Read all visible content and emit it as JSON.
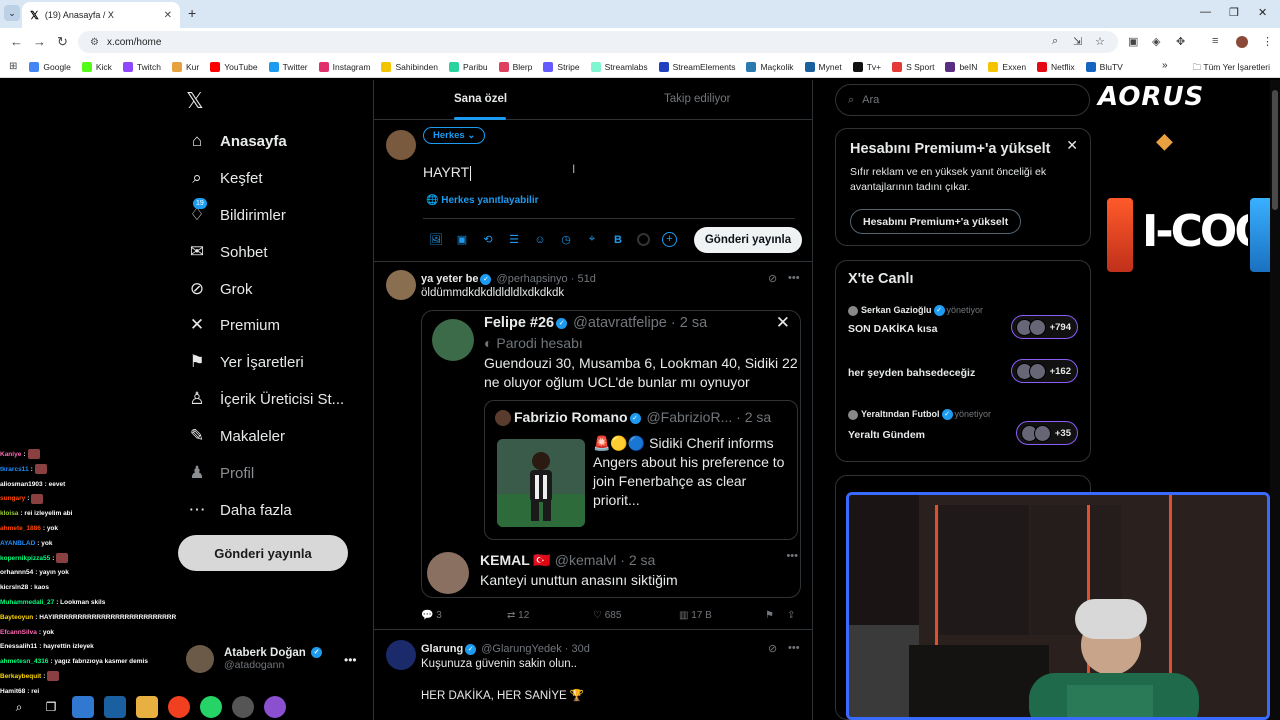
{
  "browser": {
    "tab_title": "(19) Anasayfa / X",
    "address": "x.com/home",
    "bookmarks": [
      "Google",
      "Kick",
      "Twitch",
      "Kur",
      "YouTube",
      "Twitter",
      "Instagram",
      "Sahibinden",
      "Paribu",
      "Blerp",
      "Stripe",
      "Streamlabs",
      "StreamElements",
      "Maçkolik",
      "Mynet",
      "Tv+",
      "S Sport",
      "beIN",
      "Exxen",
      "Netflix",
      "BluTV"
    ],
    "bookmark_colors": [
      "#4285f4",
      "#53fc18",
      "#9146ff",
      "#e6a23c",
      "#ff0000",
      "#1d9bf0",
      "#e1306c",
      "#f4c400",
      "#2ad4a0",
      "#e04060",
      "#635bff",
      "#80f5d2",
      "#2040c0",
      "#2a7ab0",
      "#1a5f9e",
      "#111111",
      "#e53935",
      "#5a2d82",
      "#f5c400",
      "#e50914",
      "#1565c0"
    ],
    "all_bookmarks": "Tüm Yer İşaretleri"
  },
  "nav": {
    "items": [
      {
        "label": "Anasayfa",
        "icon": "home-icon",
        "glyph": "⌂"
      },
      {
        "label": "Keşfet",
        "icon": "search-icon",
        "glyph": "⌕"
      },
      {
        "label": "Bildirimler",
        "icon": "bell-icon",
        "glyph": "♢"
      },
      {
        "label": "Sohbet",
        "icon": "mail-icon",
        "glyph": "✉"
      },
      {
        "label": "Grok",
        "icon": "grok-icon",
        "glyph": "⊘"
      },
      {
        "label": "Premium",
        "icon": "x-icon",
        "glyph": "✕"
      },
      {
        "label": "Yer İşaretleri",
        "icon": "bookmark-icon",
        "glyph": "⚑"
      },
      {
        "label": "İçerik Üreticisi St...",
        "icon": "creator-icon",
        "glyph": "♙"
      },
      {
        "label": "Makaleler",
        "icon": "article-icon",
        "glyph": "✎"
      },
      {
        "label": "Profil",
        "icon": "profile-icon",
        "glyph": "♟"
      },
      {
        "label": "Daha fazla",
        "icon": "more-icon",
        "glyph": "⋯"
      }
    ],
    "notif_count": "19",
    "post_button": "Gönderi yayınla",
    "account_name": "Ataberk Doğan",
    "account_handle": "@atadogann"
  },
  "chat": [
    {
      "user": "Kaniye",
      "color": "#ff69b4",
      "msg": ":"
    },
    {
      "user": "tkrarcs11",
      "color": "#1e90ff",
      "msg": ":"
    },
    {
      "user": "aliosman1903",
      "color": "#fff",
      "msg": ": eevet"
    },
    {
      "user": "sungary",
      "color": "#ff4500",
      "msg": ":"
    },
    {
      "user": "kloisa",
      "color": "#9acd32",
      "msg": ": rei izleyelim abi"
    },
    {
      "user": "ahmete_1886",
      "color": "#ff4500",
      "msg": ": yok"
    },
    {
      "user": "AYANBLAD",
      "color": "#1e90ff",
      "msg": ": yok"
    },
    {
      "user": "kopernikpizza55",
      "color": "#00ff7f",
      "msg": ":"
    },
    {
      "user": "orhannn54",
      "color": "#fff",
      "msg": ": yayın yok"
    },
    {
      "user": "kicrsln28",
      "color": "#fff",
      "msg": ": kaos"
    },
    {
      "user": "Muhammedali_27",
      "color": "#00ff7f",
      "msg": ": Lookman skils"
    },
    {
      "user": "Bayteoyun",
      "color": "#ffd700",
      "msg": ": HAYIRRRRRRRRRRRRRRRRRRRRRRRRRRRRRRRRRRRR"
    },
    {
      "user": "EfcannSilva",
      "color": "#ff69b4",
      "msg": ": yok"
    },
    {
      "user": "Enessalih11",
      "color": "#fff",
      "msg": ": hayrettin izleyek"
    },
    {
      "user": "ahmetesn_4316",
      "color": "#00ff7f",
      "msg": ": yagız fabrızıoya kasmer demis"
    },
    {
      "user": "Berkaybequit",
      "color": "#ffd700",
      "msg": ":"
    },
    {
      "user": "Hamit68",
      "color": "#fff",
      "msg": ": rei"
    }
  ],
  "timeline": {
    "tab_foryou": "Sana özel",
    "tab_following": "Takip ediliyor",
    "audience": "Herkes",
    "draft": "HAYRT",
    "reply_setting": "Herkes yanıtlayabilir",
    "post_button": "Gönderi yayınla",
    "tools": [
      "🖼",
      "▣",
      "⟲",
      "☰",
      "☺",
      "◷",
      "⌖",
      "B"
    ]
  },
  "tweet1": {
    "name": "ya yeter be",
    "handle": "@perhapsinyo",
    "time": "51d",
    "text": "öldümmdkdkdldldldlxdkdkdk",
    "quote": {
      "name": "Felipe #26",
      "handle": "@atavratfelipe",
      "time": "2 sa",
      "sub": "Parodi hesabı",
      "text": "Guendouzi 30, Musamba 6, Lookman 40, Sidiki 22 ne oluyor oğlum UCL'de bunlar mı oynuyor",
      "inner": {
        "name": "Fabrizio Romano",
        "handle": "@FabrizioR...",
        "time": "2 sa",
        "text": "🚨🟡🔵 Sidiki Cherif informs Angers about his preference to join Fenerbahçe as clear priorit..."
      },
      "reply": {
        "name": "KEMAL 🇹🇷",
        "handle": "@kemalvl",
        "time": "2 sa",
        "text": "Kanteyi unuttun anasını siktiğim"
      }
    },
    "replies": "3",
    "retweets": "12",
    "likes": "685",
    "views": "17 B"
  },
  "tweet2": {
    "name": "Glarung",
    "handle": "@GlarungYedek",
    "time": "30d",
    "text": "Kuşunuza güvenin sakin olun..",
    "text2": "HER DAKİKA, HER SANİYE 🏆"
  },
  "sidebar": {
    "search_placeholder": "Ara",
    "premium_title": "Hesabını Premium+'a yükselt",
    "premium_desc": "Sıfır reklam ve en yüksek yanıt önceliği ek avantajlarının tadını çıkar.",
    "premium_button": "Hesabını Premium+'a yükselt",
    "live_title": "X'te Canlı",
    "spaces": [
      {
        "host": "Serkan Gazioğlu",
        "role": "yönetiyor",
        "name": "SON DAKİKA kısa",
        "count": "+794"
      },
      {
        "host": "",
        "role": "",
        "name": "her şeyden bahsedeceğiz",
        "count": "+162"
      },
      {
        "host": "Yeraltından Futbol",
        "role": "yönetiyor",
        "name": "Yeraltı Gündem",
        "count": "+35"
      }
    ]
  },
  "overlay": {
    "brand1": "AORUS",
    "brand2": "I-COOL"
  }
}
